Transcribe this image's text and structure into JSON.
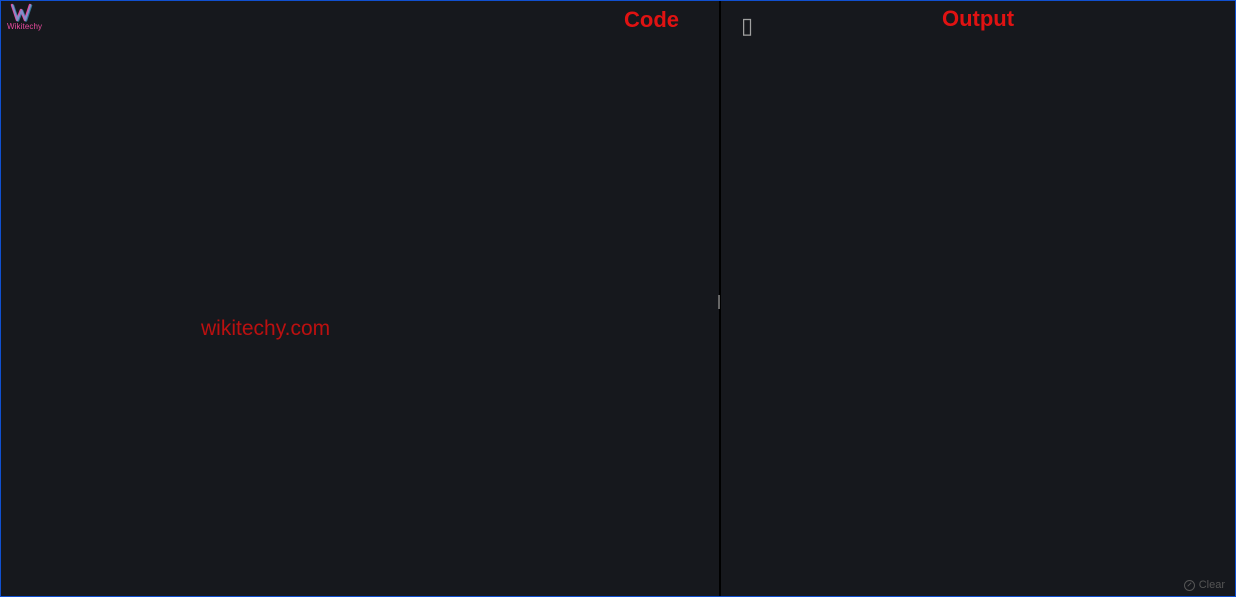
{
  "logo": {
    "text": "Wikitechy"
  },
  "panes": {
    "left": {
      "title": "Code"
    },
    "right": {
      "title": "Output",
      "cursor": "▯"
    }
  },
  "watermark": "wikitechy.com",
  "toolbar": {
    "clear_label": "Clear"
  }
}
